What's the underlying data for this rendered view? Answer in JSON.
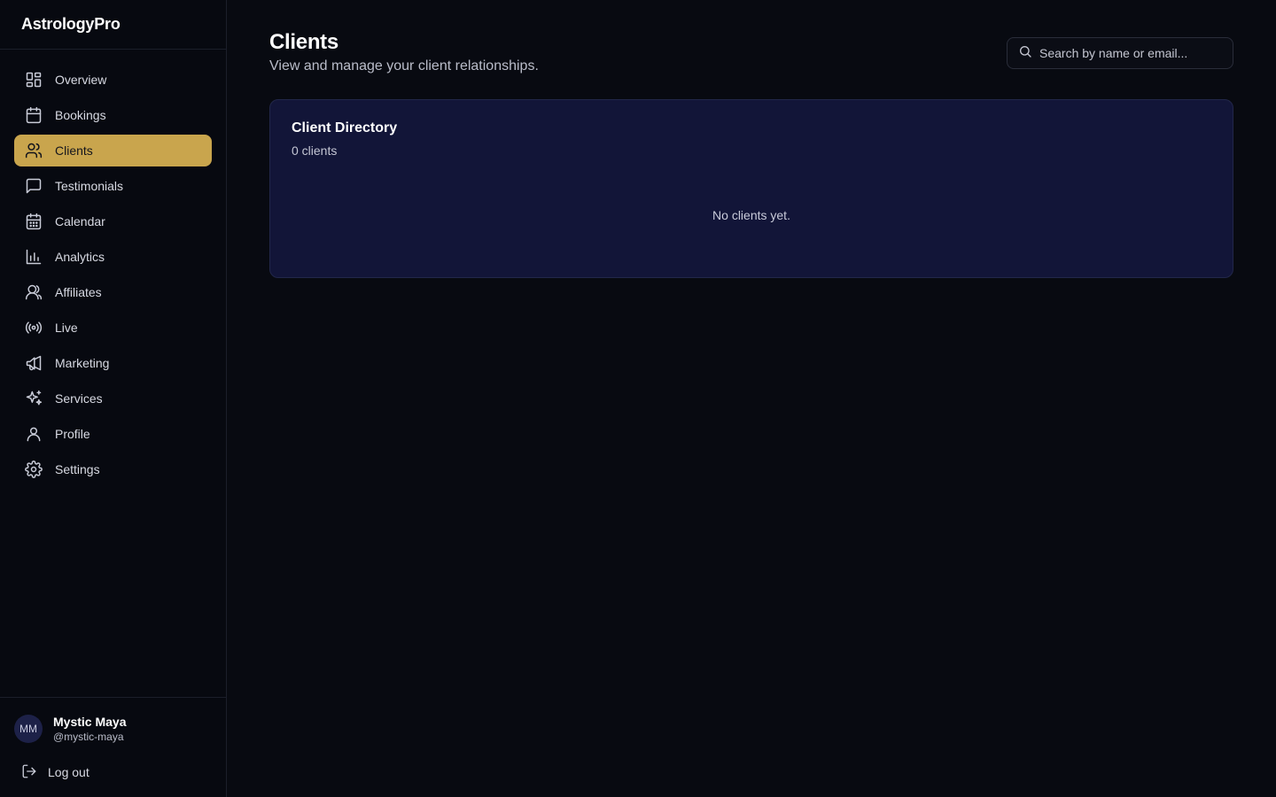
{
  "app": {
    "name": "AstrologyPro"
  },
  "sidebar": {
    "items": [
      {
        "label": "Overview",
        "icon": "grid-icon"
      },
      {
        "label": "Bookings",
        "icon": "calendar-icon"
      },
      {
        "label": "Clients",
        "icon": "users-icon",
        "active": true
      },
      {
        "label": "Testimonials",
        "icon": "message-square-icon"
      },
      {
        "label": "Calendar",
        "icon": "calendar-days-icon"
      },
      {
        "label": "Analytics",
        "icon": "bar-chart-icon"
      },
      {
        "label": "Affiliates",
        "icon": "user-group-icon"
      },
      {
        "label": "Live",
        "icon": "radio-icon"
      },
      {
        "label": "Marketing",
        "icon": "megaphone-icon"
      },
      {
        "label": "Services",
        "icon": "sparkles-icon"
      },
      {
        "label": "Profile",
        "icon": "user-icon"
      },
      {
        "label": "Settings",
        "icon": "gear-icon"
      }
    ],
    "user": {
      "initials": "MM",
      "name": "Mystic Maya",
      "handle": "@mystic-maya"
    },
    "logout_label": "Log out"
  },
  "page": {
    "title": "Clients",
    "subtitle": "View and manage your client relationships."
  },
  "search": {
    "placeholder": "Search by name or email...",
    "value": ""
  },
  "directory": {
    "title": "Client Directory",
    "count": "0 clients",
    "empty_message": "No clients yet."
  },
  "colors": {
    "background": "#080a11",
    "accent": "#c9a54d",
    "card": "#121538",
    "avatar": "#1d2148"
  }
}
